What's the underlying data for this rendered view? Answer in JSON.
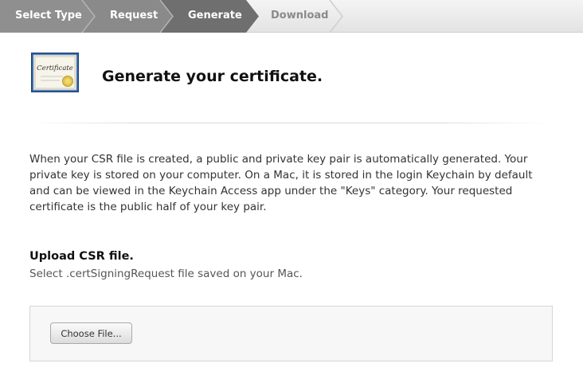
{
  "steps": [
    {
      "label": "Select Type",
      "state": "done"
    },
    {
      "label": "Request",
      "state": "done"
    },
    {
      "label": "Generate",
      "state": "current"
    },
    {
      "label": "Download",
      "state": "upcoming"
    }
  ],
  "colors": {
    "step_done": "#8f8f8f",
    "step_current": "#6e6e6e",
    "step_upcoming": "#e6e6e6",
    "accent_gold": "#e2c44a",
    "certificate_blue": "#2a5d9f"
  },
  "header": {
    "icon": "certificate-icon",
    "icon_text": "Certificate",
    "title": "Generate your certificate."
  },
  "intro": "When your CSR file is created, a public and private key pair is automatically generated. Your private key is stored on your computer. On a Mac, it is stored in the login Keychain by default and can be viewed in the Keychain Access app under the \"Keys\" category. Your requested certificate is the public half of your key pair.",
  "upload": {
    "title": "Upload CSR file.",
    "desc": "Select .certSigningRequest file saved on your Mac.",
    "button_label": "Choose File..."
  }
}
